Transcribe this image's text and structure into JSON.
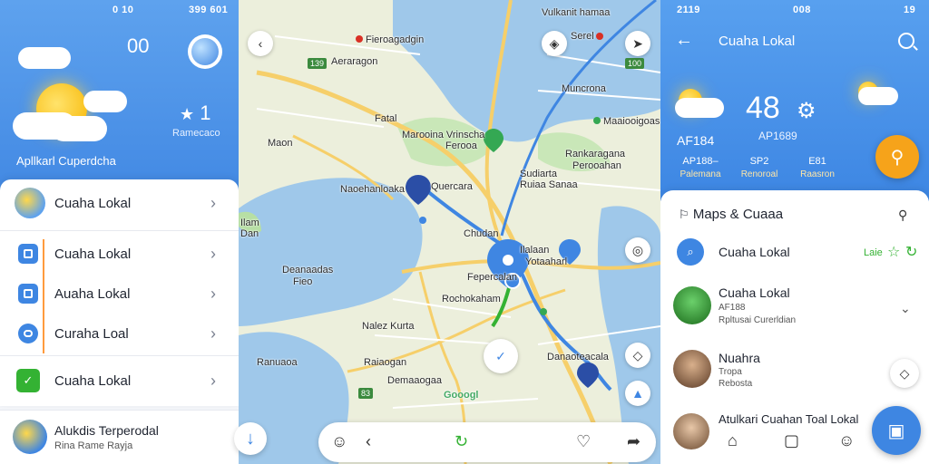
{
  "left": {
    "status_left": "0 10",
    "status_right": "399 601",
    "hero_number": "00",
    "hero_temp": "1",
    "hero_sub": "Ramecaco",
    "app_title": "Apllkarl Cuperdcha",
    "items": [
      {
        "label": "Cuaha Lokal",
        "icon": "sun-icon"
      },
      {
        "label": "Cuaha Lokal",
        "icon": "square-icon"
      },
      {
        "label": "Auaha Lokal",
        "icon": "square-icon"
      },
      {
        "label": "Curaha Loal",
        "icon": "cloud-icon"
      },
      {
        "label": "Cuaha Lokal",
        "icon": "check-icon"
      }
    ],
    "bottom_title": "Alukdis Terperodal",
    "bottom_sub": "Rina Rame Rayja"
  },
  "map": {
    "labels": [
      {
        "text": "Fieroagadgin",
        "name": "map-label-fieroagadgin"
      },
      {
        "text": "Aeraragon",
        "name": "map-label-aeraragon"
      },
      {
        "text": "Vulkanit hamaa",
        "name": "map-label-vulkanit-hamaa"
      },
      {
        "text": "Serel",
        "name": "map-label-serel"
      },
      {
        "text": "Muncrona",
        "name": "map-label-muncrona"
      },
      {
        "text": "Fatal",
        "name": "map-label-fatal"
      },
      {
        "text": "Marooina Vrinscha",
        "name": "map-label-marooina"
      },
      {
        "text": "Ferooa",
        "name": "map-label-ferooa"
      },
      {
        "text": "Maaiooigoas",
        "name": "map-label-maaiooigoas"
      },
      {
        "text": "Maon",
        "name": "map-label-maon"
      },
      {
        "text": "Rankaragana",
        "name": "map-label-rankaragana"
      },
      {
        "text": "Perooahan",
        "name": "map-label-perooahan"
      },
      {
        "text": "Sudiarta",
        "name": "map-label-sudiarta"
      },
      {
        "text": "Ruiaa Sanaa",
        "name": "map-label-ruiaa-sanaa"
      },
      {
        "text": "Naoehanloaka",
        "name": "map-label-naoehanloaka"
      },
      {
        "text": "Quercara",
        "name": "map-label-quercara"
      },
      {
        "text": "Chudan",
        "name": "map-label-chudan"
      },
      {
        "text": "Ilalaan",
        "name": "map-label-ilalaan"
      },
      {
        "text": "Yotaaharl",
        "name": "map-label-yotaaharl"
      },
      {
        "text": "Fepercalan",
        "name": "map-label-fepercalan"
      },
      {
        "text": "Deanaadas",
        "name": "map-label-deanaadas"
      },
      {
        "text": "Fieo",
        "name": "map-label-fieo"
      },
      {
        "text": "Rochokaham",
        "name": "map-label-rochokaham"
      },
      {
        "text": "Nalez Kurta",
        "name": "map-label-nalez-kurta"
      },
      {
        "text": "Ranuaoa",
        "name": "map-label-ranuaoa"
      },
      {
        "text": "Raiaogan",
        "name": "map-label-raiaogan"
      },
      {
        "text": "Demaaogaa",
        "name": "map-label-demaaogaa"
      },
      {
        "text": "Danaoteacala",
        "name": "map-label-danaoteacala"
      },
      {
        "text": "Ilam",
        "name": "map-label-ilam"
      },
      {
        "text": "Dan",
        "name": "map-label-dan"
      }
    ],
    "badges": [
      "139",
      "100",
      "83"
    ],
    "watermark": "Gooogl"
  },
  "right": {
    "status_left": "2119",
    "status_right": "008",
    "status_end": "19",
    "title": "Cuaha Lokal",
    "temp": "48",
    "sub_left": "AF184",
    "sub_mid": "AP1689",
    "stats": [
      {
        "value": "AP188–",
        "sub": "Palemana"
      },
      {
        "value": "SP2",
        "sub": "Renoroal"
      },
      {
        "value": "E81",
        "sub": "Raasron"
      }
    ],
    "section_title": "Maps & Cuaaa",
    "rows": [
      {
        "title": "Cuaha Lokal",
        "sub": "",
        "tag": "Laie"
      },
      {
        "title": "Cuaha Lokal",
        "sub": "AF188",
        "sub2": "Rpltusai Curerldian"
      },
      {
        "title": "Nuahra",
        "sub": "Tropa",
        "sub2": "Rebosta"
      },
      {
        "title": "Atulkari Cuahan Toal Lokal",
        "sub": "",
        "sub2": ""
      }
    ]
  }
}
